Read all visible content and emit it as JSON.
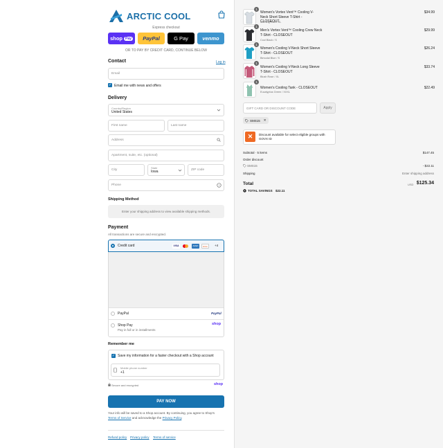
{
  "brand": {
    "name": "ARCTIC COOL",
    "accent": "#1773b0",
    "logo_color": "#1b6fa8"
  },
  "express": {
    "title": "Express checkout",
    "buttons": [
      {
        "label": "shop",
        "pill": "Pay",
        "color": "#5a31f4"
      },
      {
        "label": "PayPal",
        "color": "#ffc439"
      },
      {
        "label": "G Pay",
        "color": "#000000"
      },
      {
        "label": "venmo",
        "color": "#3d95ce"
      }
    ],
    "or_text": "OR TO PAY BY CREDIT CARD, CONTINUE BELOW"
  },
  "contact": {
    "title": "Contact",
    "login": "Log in",
    "email_placeholder": "Email",
    "news_label": "Email me with news and offers"
  },
  "delivery": {
    "title": "Delivery",
    "country_label": "Country/Region",
    "country_value": "United States",
    "first_name": "First name",
    "last_name": "Last name",
    "address": "Address",
    "apartment": "Apartment, suite, etc. (optional)",
    "city": "City",
    "state_label": "State",
    "state_value": "Iowa",
    "zip": "ZIP code",
    "phone": "Phone"
  },
  "shipping": {
    "title": "Shipping Method",
    "note": "Enter your shipping address to view available shipping methods."
  },
  "payment": {
    "title": "Payment",
    "subtitle": "All transactions are secure and encrypted.",
    "credit_card": "Credit card",
    "cards": [
      "VISA",
      "MC",
      "AMEX",
      "DISC"
    ],
    "more": "+4",
    "paypal": "PayPal",
    "paypal_logo": "PayPal",
    "shoppay": "Shop Pay",
    "shoppay_sub": "Pay in full or in installments",
    "shoppay_logo": "shop"
  },
  "remember": {
    "title": "Remember me",
    "save_label": "Save my information for a faster checkout with a Shop account",
    "mobile_label": "Mobile phone number",
    "mobile_value": "+1",
    "secure": "Secure and encrypted",
    "shop_logo": "shop"
  },
  "pay_now": "PAY NOW",
  "terms": {
    "text1": "Your info will be saved to a Shop account. By continuing, you agree to Shop's",
    "tos": "Terms of Service",
    "and": "and acknowledge the",
    "privacy": "Privacy Policy",
    "end": "."
  },
  "footer": {
    "links": [
      "Refund policy",
      "Privacy policy",
      "Terms of service"
    ]
  },
  "items": [
    {
      "qty": "1",
      "name": "Women's Vortex Vent™ Cooling V-Neck Short Sleeve T-Shirt - CLOSEOUT",
      "variant": "Morning Rain / XL",
      "price": "$34.99",
      "color": "#d8dde3"
    },
    {
      "qty": "1",
      "name": "Men's Vortex Vent™ Cooling Crew Neck T-Shirt - CLOSEOUT",
      "variant": "Cool Black / S",
      "price": "$29.99",
      "color": "#2b2d31"
    },
    {
      "qty": "1",
      "name": "Women's Cooling V-Neck Short Sleeve T-Shirt - CLOSEOUT",
      "variant": "Bimodal Blue / S",
      "price": "$26.24",
      "color": "#1f9fc4"
    },
    {
      "qty": "1",
      "name": "Women's Cooling V-Neck Long Sleeve T-Shirt - CLOSEOUT",
      "variant": "Blush Rose / XL",
      "price": "$33.74",
      "color": "#c45a7a"
    },
    {
      "qty": "1",
      "name": "Women's Cooling Tank - CLOSEOUT",
      "variant": "Eucalyptus Green / XXXL",
      "price": "$22.49",
      "color": "#8fc3b0"
    }
  ],
  "discount": {
    "placeholder": "GIFT CARD OR DISCOUNT CODE",
    "apply": "Apply",
    "tag": "SMS15"
  },
  "govx": {
    "text": "Discount available for select eligible groups with GOVX ID"
  },
  "summary": {
    "subtotal_label": "Subtotal · 5 items",
    "subtotal": "$147.45",
    "order_discount": "Order discount",
    "code": "SMS15",
    "code_amount": "- $22.11",
    "shipping_label": "Shipping",
    "shipping_value": "Enter shipping address",
    "total_label": "Total",
    "currency": "USD",
    "total": "$125.34",
    "savings_label": "TOTAL SAVINGS",
    "savings": "$22.11"
  }
}
